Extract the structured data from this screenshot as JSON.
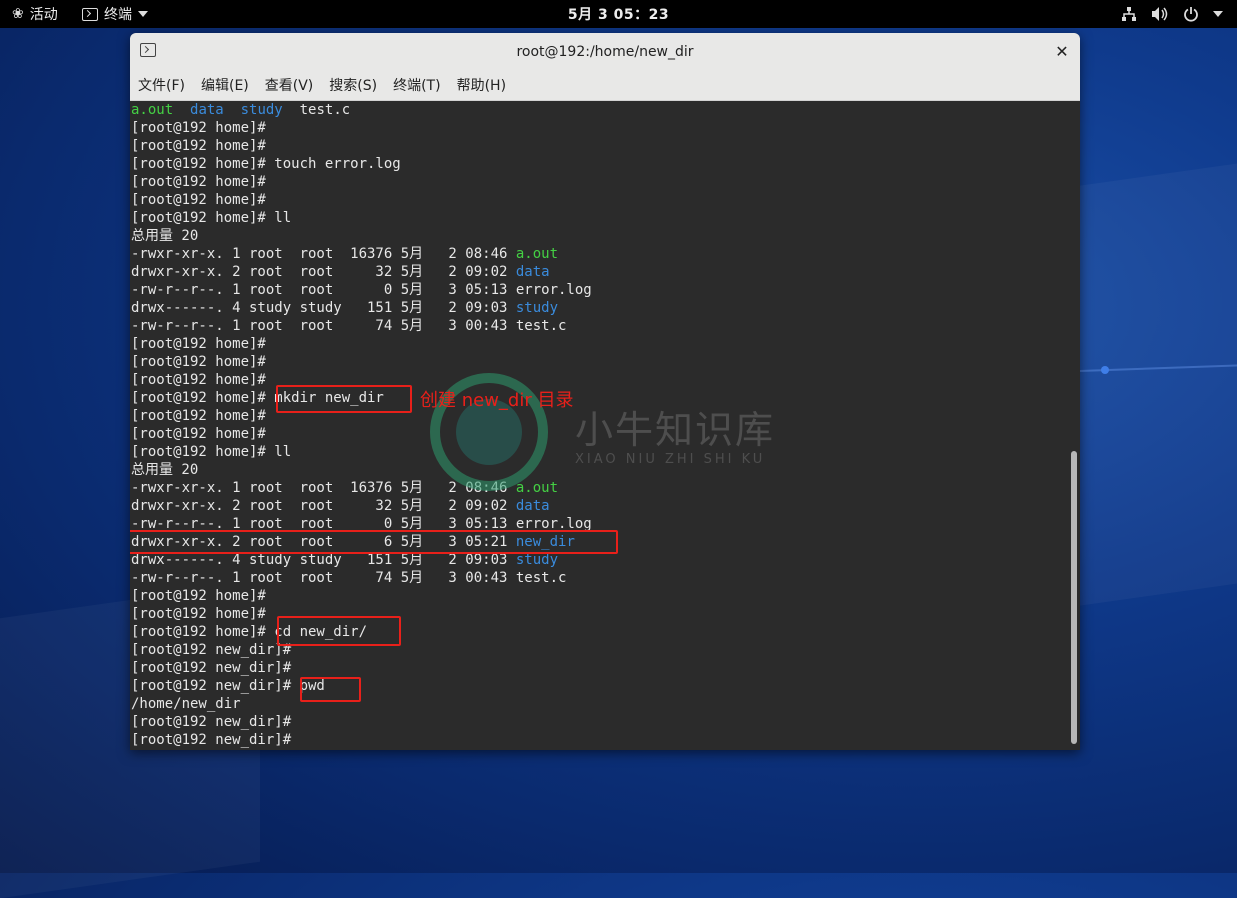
{
  "topbar": {
    "activities_label": "活动",
    "app_label": "终端",
    "clock": "5月 3  05：23"
  },
  "window": {
    "title": "root@192:/home/new_dir",
    "menu": [
      "文件(F)",
      "编辑(E)",
      "查看(V)",
      "搜索(S)",
      "终端(T)",
      "帮助(H)"
    ]
  },
  "terminal": {
    "lines": [
      [
        {
          "t": "a.out",
          "c": "g"
        },
        {
          "t": "  "
        },
        {
          "t": "data",
          "c": "b"
        },
        {
          "t": "  "
        },
        {
          "t": "study",
          "c": "b"
        },
        {
          "t": "  test.c"
        }
      ],
      [
        {
          "t": "[root@192 home]#"
        }
      ],
      [
        {
          "t": "[root@192 home]#"
        }
      ],
      [
        {
          "t": "[root@192 home]# touch error.log"
        }
      ],
      [
        {
          "t": "[root@192 home]#"
        }
      ],
      [
        {
          "t": "[root@192 home]#"
        }
      ],
      [
        {
          "t": "[root@192 home]# ll"
        }
      ],
      [
        {
          "t": "总用量 20"
        }
      ],
      [
        {
          "t": "-rwxr-xr-x. 1 root  root  16376 5月   2 08:46 "
        },
        {
          "t": "a.out",
          "c": "g"
        }
      ],
      [
        {
          "t": "drwxr-xr-x. 2 root  root     32 5月   2 09:02 "
        },
        {
          "t": "data",
          "c": "b"
        }
      ],
      [
        {
          "t": "-rw-r--r--. 1 root  root      0 5月   3 05:13 error.log"
        }
      ],
      [
        {
          "t": "drwx------. 4 study study   151 5月   2 09:03 "
        },
        {
          "t": "study",
          "c": "b"
        }
      ],
      [
        {
          "t": "-rw-r--r--. 1 root  root     74 5月   3 00:43 test.c"
        }
      ],
      [
        {
          "t": "[root@192 home]#"
        }
      ],
      [
        {
          "t": "[root@192 home]#"
        }
      ],
      [
        {
          "t": "[root@192 home]#"
        }
      ],
      [
        {
          "t": "[root@192 home]# mkdir new_dir"
        }
      ],
      [
        {
          "t": "[root@192 home]#"
        }
      ],
      [
        {
          "t": "[root@192 home]#"
        }
      ],
      [
        {
          "t": "[root@192 home]# ll"
        }
      ],
      [
        {
          "t": "总用量 20"
        }
      ],
      [
        {
          "t": "-rwxr-xr-x. 1 root  root  16376 5月   2 08:46 "
        },
        {
          "t": "a.out",
          "c": "g"
        }
      ],
      [
        {
          "t": "drwxr-xr-x. 2 root  root     32 5月   2 09:02 "
        },
        {
          "t": "data",
          "c": "b"
        }
      ],
      [
        {
          "t": "-rw-r--r--. 1 root  root      0 5月   3 05:13 error.log"
        }
      ],
      [
        {
          "t": "drwxr-xr-x. 2 root  root      6 5月   3 05:21 "
        },
        {
          "t": "new_dir",
          "c": "b"
        }
      ],
      [
        {
          "t": "drwx------. 4 study study   151 5月   2 09:03 "
        },
        {
          "t": "study",
          "c": "b"
        }
      ],
      [
        {
          "t": "-rw-r--r--. 1 root  root     74 5月   3 00:43 test.c"
        }
      ],
      [
        {
          "t": "[root@192 home]#"
        }
      ],
      [
        {
          "t": "[root@192 home]#"
        }
      ],
      [
        {
          "t": "[root@192 home]# cd new_dir/"
        }
      ],
      [
        {
          "t": "[root@192 new_dir]#"
        }
      ],
      [
        {
          "t": "[root@192 new_dir]#"
        }
      ],
      [
        {
          "t": "[root@192 new_dir]# pwd"
        }
      ],
      [
        {
          "t": "/home/new_dir"
        }
      ],
      [
        {
          "t": "[root@192 new_dir]#"
        }
      ],
      [
        {
          "t": "[root@192 new_dir]#"
        }
      ]
    ]
  },
  "annotation": {
    "mkdir_note": "创建 new_dir 目录"
  },
  "watermark": {
    "title": "小牛知识库",
    "subtitle": "XIAO NIU ZHI SHI KU"
  },
  "colors": {
    "accent_red": "#e8201a",
    "ls_green": "#44d044",
    "ls_blue": "#3a8bdc"
  }
}
